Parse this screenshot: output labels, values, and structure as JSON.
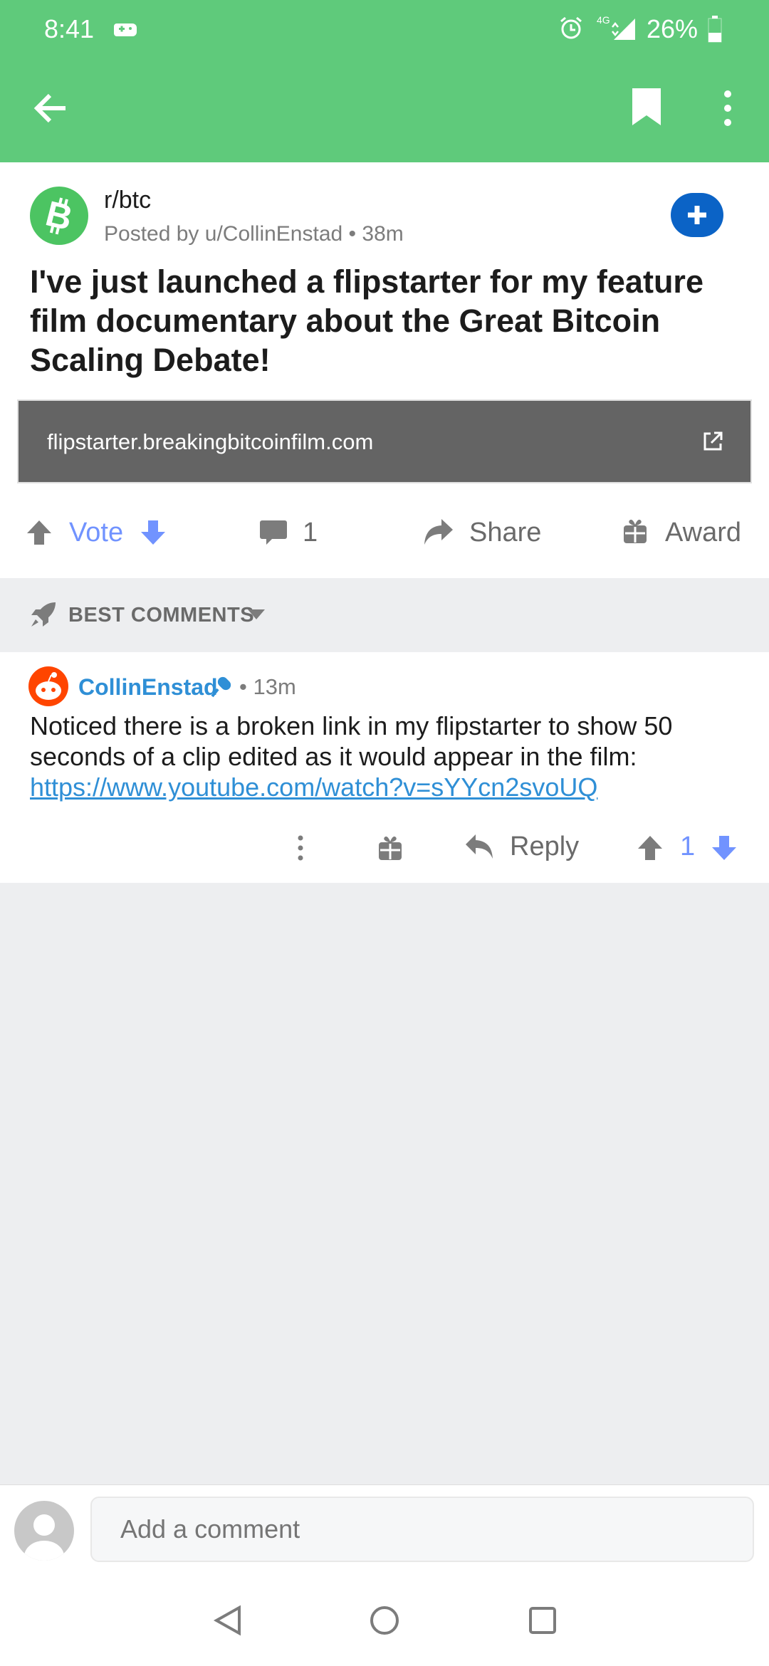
{
  "status": {
    "time": "8:41",
    "network": "4G",
    "battery": "26%"
  },
  "post": {
    "subreddit": "r/btc",
    "posted_by": "Posted by u/CollinEnstad",
    "age": "38m",
    "title": "I've just launched a flipstarter for my feature film documentary about the Great Bitcoin Scaling Debate!",
    "link": "flipstarter.breakingbitcoinfilm.com"
  },
  "actions": {
    "vote": "Vote",
    "comments": "1",
    "share": "Share",
    "award": "Award"
  },
  "sort": {
    "label": "BEST COMMENTS"
  },
  "comment": {
    "user": "CollinEnstad",
    "time": "13m",
    "text": "Noticed there is a broken link in my flipstarter to show 50 seconds of a clip edited as it would appear in the film:",
    "url": "https://www.youtube.com/watch?v=sYYcn2svoUQ",
    "reply": "Reply",
    "score": "1"
  },
  "composer": {
    "placeholder": "Add a comment"
  },
  "colors": {
    "app_bar": "#5fca7b",
    "accent_blue": "#2f8fd6",
    "vote_blue": "#7193ff",
    "join_button": "#0b63c6"
  }
}
